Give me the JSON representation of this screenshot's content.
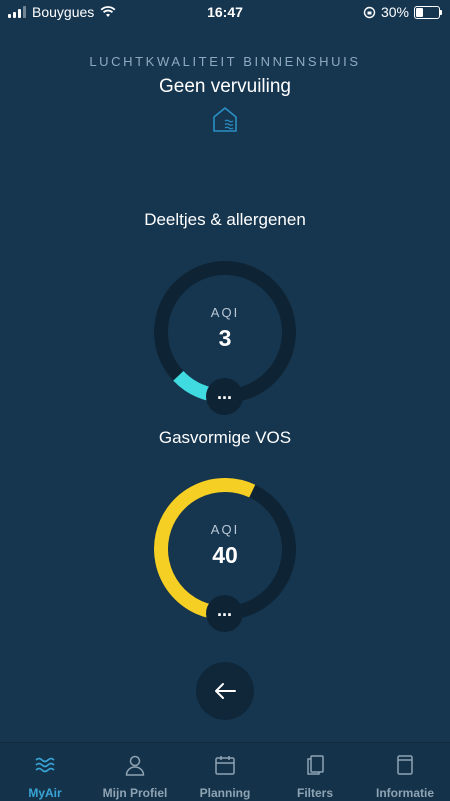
{
  "status_bar": {
    "carrier": "Bouygues",
    "time": "16:47",
    "battery_percent": "30%",
    "battery_level": 0.3
  },
  "header": {
    "section_label": "LUCHTKWALITEIT BINNENSHUIS",
    "headline": "Geen vervuiling",
    "icon": "home-air-icon"
  },
  "sensors": [
    {
      "title": "Deeltjes & allergenen",
      "label": "AQI",
      "value": "3",
      "arc_color": "#3fdbe0",
      "arc_fraction": 0.13,
      "more": "..."
    },
    {
      "title": "Gasvormige VOS",
      "label": "AQI",
      "value": "40",
      "arc_color": "#f5cf24",
      "arc_fraction": 0.57,
      "more": "..."
    }
  ],
  "back_button": {
    "icon": "arrow-left-icon"
  },
  "tab_bar": {
    "active": "MyAir",
    "tabs": [
      {
        "label": "MyAir",
        "icon": "waves-icon"
      },
      {
        "label": "Mijn Profiel",
        "icon": "person-icon"
      },
      {
        "label": "Planning",
        "icon": "calendar-icon"
      },
      {
        "label": "Filters",
        "icon": "filters-icon"
      },
      {
        "label": "Informatie",
        "icon": "info-book-icon"
      }
    ]
  },
  "colors": {
    "background": "#163650",
    "ring_track": "#0e2434",
    "accent": "#39a4d7"
  }
}
